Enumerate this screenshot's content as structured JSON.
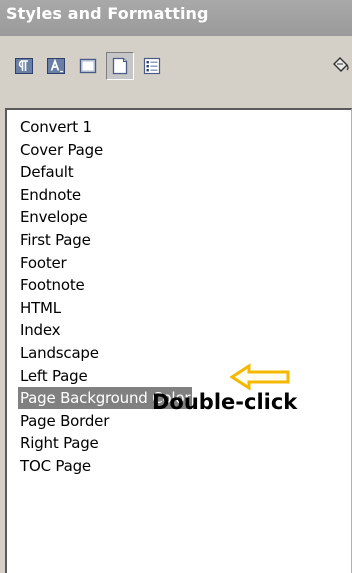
{
  "window": {
    "title": "Styles and Formatting"
  },
  "toolbar": {
    "buttons": [
      {
        "name": "paragraph-styles",
        "icon": "paragraph-styles-icon",
        "active": false
      },
      {
        "name": "character-styles",
        "icon": "character-styles-icon",
        "active": false
      },
      {
        "name": "frame-styles",
        "icon": "frame-styles-icon",
        "active": false
      },
      {
        "name": "page-styles",
        "icon": "page-styles-icon",
        "active": true
      },
      {
        "name": "list-styles",
        "icon": "list-styles-icon",
        "active": false
      },
      {
        "name": "fill-format-mode",
        "icon": "paint-bucket-icon",
        "active": false
      }
    ]
  },
  "styles_list": {
    "items": [
      {
        "label": "Convert 1",
        "selected": false
      },
      {
        "label": "Cover Page",
        "selected": false
      },
      {
        "label": "Default",
        "selected": false
      },
      {
        "label": "Endnote",
        "selected": false
      },
      {
        "label": "Envelope",
        "selected": false
      },
      {
        "label": "First Page",
        "selected": false
      },
      {
        "label": "Footer",
        "selected": false
      },
      {
        "label": "Footnote",
        "selected": false
      },
      {
        "label": "HTML",
        "selected": false
      },
      {
        "label": "Index",
        "selected": false
      },
      {
        "label": "Landscape",
        "selected": false
      },
      {
        "label": "Left Page",
        "selected": false
      },
      {
        "label": "Page Background Color",
        "selected": true
      },
      {
        "label": "Page Border",
        "selected": false
      },
      {
        "label": "Right Page",
        "selected": false
      },
      {
        "label": "TOC Page",
        "selected": false
      }
    ]
  },
  "annotation": {
    "text": "Double-click",
    "arrow_color": "#f5b800",
    "selection_color": "#808080"
  }
}
